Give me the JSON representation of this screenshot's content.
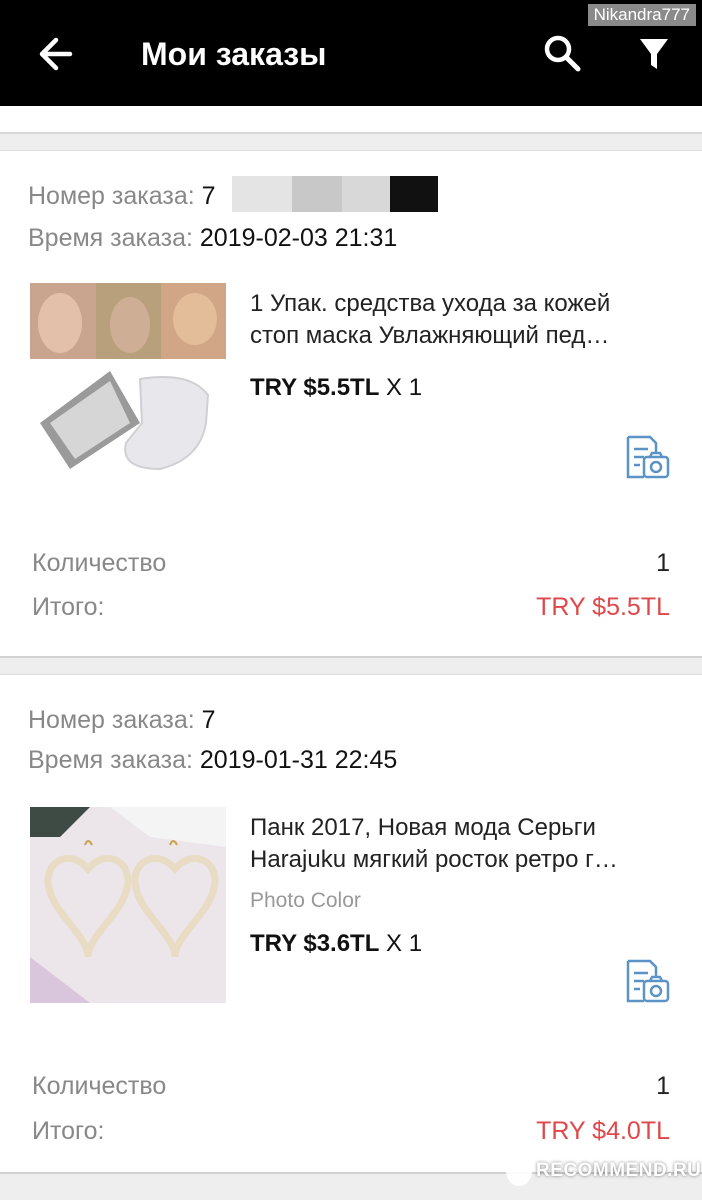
{
  "app_bar": {
    "title": "Мои заказы",
    "back_icon": "arrow-left-icon",
    "search_icon": "search-icon",
    "filter_icon": "filter-icon",
    "background": "#000000"
  },
  "watermark": {
    "user": "Nikandra777",
    "site": "RECOMMEND.RU"
  },
  "labels": {
    "order_number": "Номер заказа:",
    "order_time": "Время заказа:",
    "quantity": "Количество",
    "total": "Итого:"
  },
  "accent": {
    "total_color": "#e0474a"
  },
  "orders": [
    {
      "order_number_visible": "7",
      "order_time": "2019-02-03 21:31",
      "product_name_line1": "1 Упак. средства ухода за кожей",
      "product_name_line2": "стоп маска Увлажняющий пед…",
      "variant": "",
      "price": "TRY $5.5TL",
      "qty_mult": "X 1",
      "quantity": "1",
      "total": "TRY $5.5TL",
      "review_icon": "review-photo-icon"
    },
    {
      "order_number_visible": "7",
      "order_time": "2019-01-31 22:45",
      "product_name_line1": "Панк 2017, Новая мода Серьги",
      "product_name_line2": "Harajuku мягкий росток ретро г…",
      "variant": "Photo Color",
      "price": "TRY $3.6TL",
      "qty_mult": "X 1",
      "quantity": "1",
      "total": "TRY $4.0TL",
      "review_icon": "review-photo-icon"
    }
  ]
}
